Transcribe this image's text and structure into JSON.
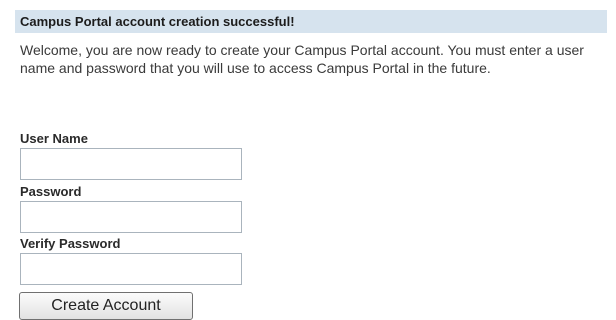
{
  "banner": {
    "title": "Campus Portal account creation successful!"
  },
  "welcome": {
    "text": "Welcome, you are now ready to create your Campus Portal account. You must enter a user name and password that you will use to access Campus Portal in the future."
  },
  "form": {
    "user_name": {
      "label": "User Name",
      "value": ""
    },
    "password": {
      "label": "Password",
      "value": ""
    },
    "verify_password": {
      "label": "Verify Password",
      "value": ""
    },
    "submit_label": "Create Account"
  },
  "colors": {
    "banner_background": "#d6e3ee",
    "input_border": "#aab4bd",
    "text": "#333333"
  }
}
